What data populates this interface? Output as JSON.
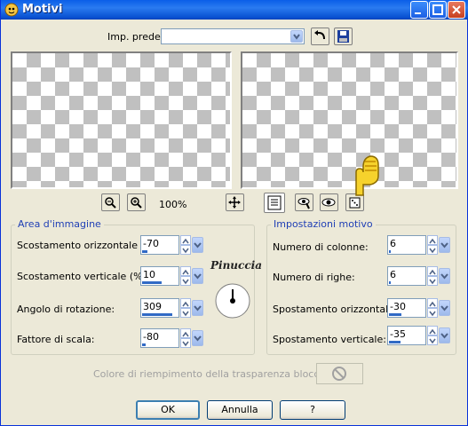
{
  "window": {
    "title": "Motivi"
  },
  "toolbar": {
    "preset_label": "Imp. predef.:",
    "preset_value": ""
  },
  "zoom": {
    "level": "100%"
  },
  "watermark": "Pinuccia",
  "area_group": {
    "title": "Area d'immagine",
    "fields": [
      {
        "label": "Scostamento orizzontale (%):",
        "value": "-70",
        "fill": 0.15
      },
      {
        "label": "Scostamento verticale (%):",
        "value": "10",
        "fill": 0.55
      },
      {
        "label": "Angolo di rotazione:",
        "value": "309",
        "fill": 0.86
      },
      {
        "label": "Fattore di scala:",
        "value": "-80",
        "fill": 0.1
      }
    ]
  },
  "motif_group": {
    "title": "Impostazioni motivo",
    "fields": [
      {
        "label": "Numero di colonne:",
        "value": "6",
        "fill": 0.05
      },
      {
        "label": "Numero di righe:",
        "value": "6",
        "fill": 0.05
      },
      {
        "label": "Spostamento orizzontale:",
        "value": "-30",
        "fill": 0.35
      },
      {
        "label": "Spostamento verticale:",
        "value": "-35",
        "fill": 0.33
      }
    ]
  },
  "transparency": {
    "label": "Colore di riempimento della trasparenza bloccato:"
  },
  "buttons": {
    "ok": "OK",
    "cancel": "Annulla",
    "help": "?"
  },
  "colors": {
    "title_bar": "#0a5ee8",
    "accent": "#316ac5",
    "group_title": "#1f3fb5"
  }
}
